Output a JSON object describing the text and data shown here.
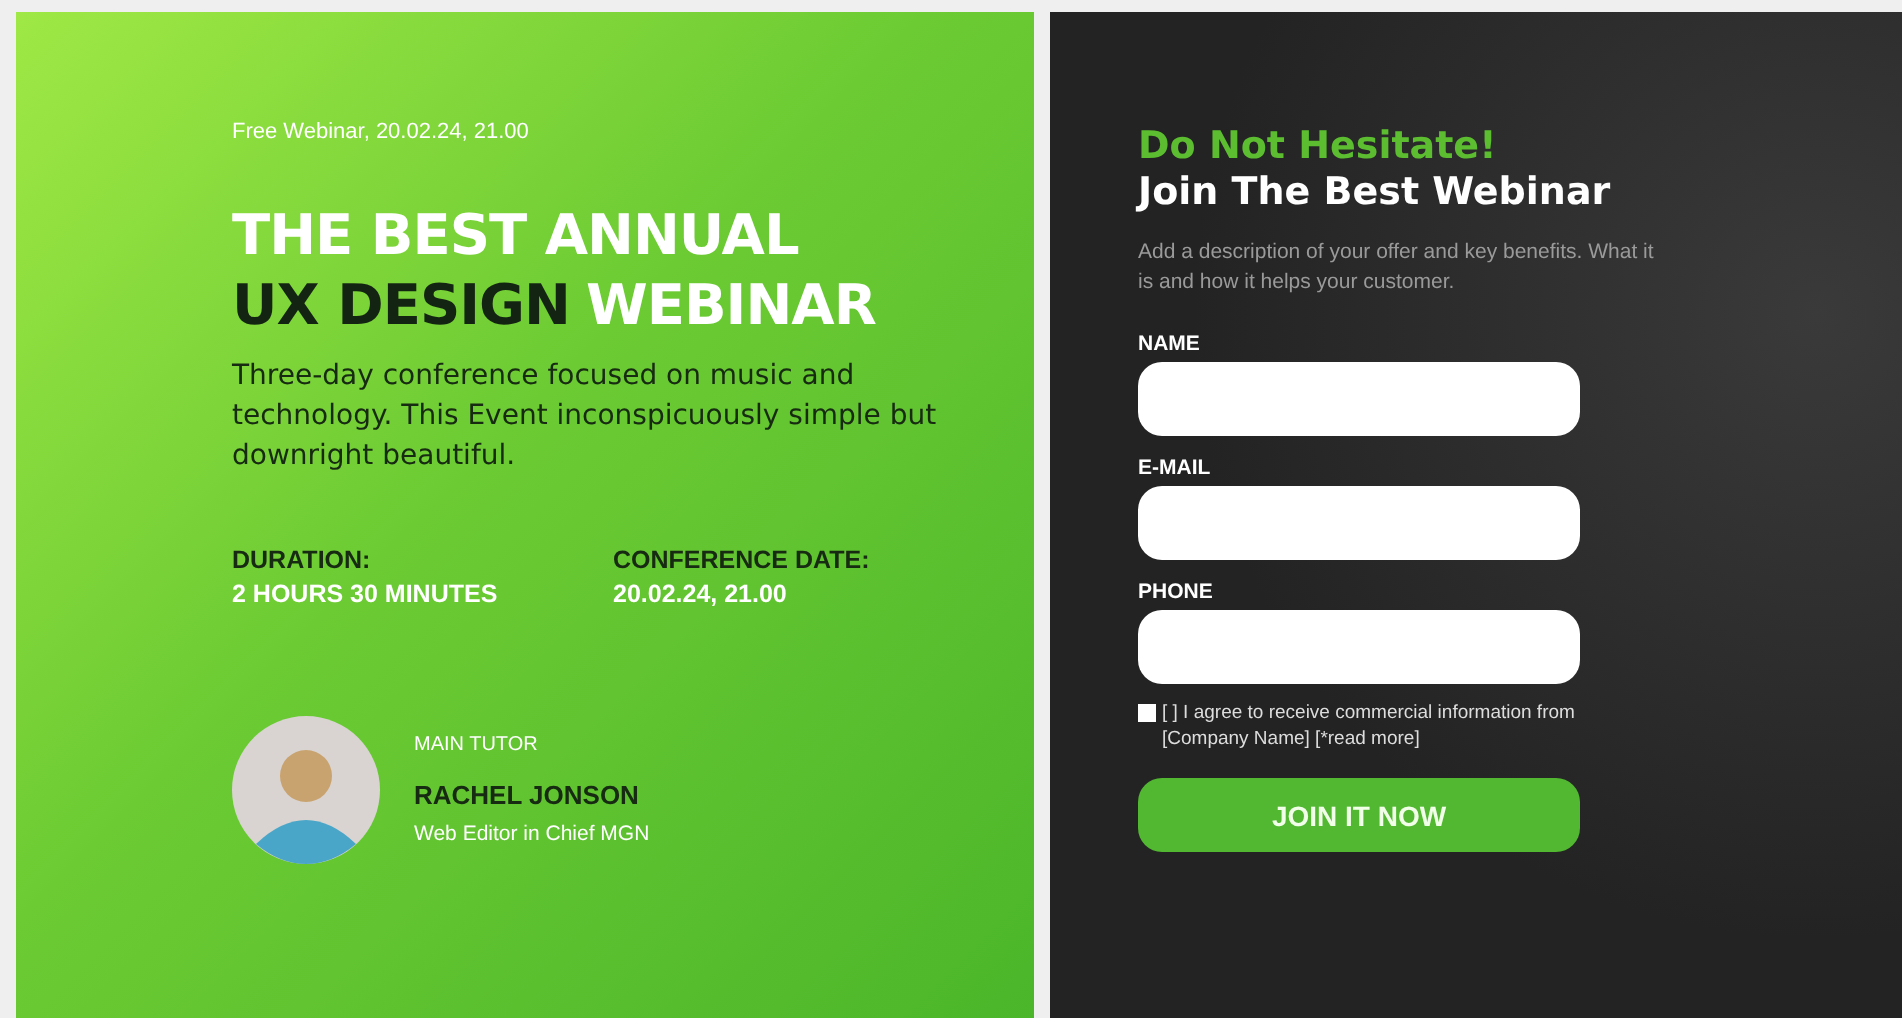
{
  "promo": {
    "eyebrow": "Free Webinar, 20.02.24, 21.00",
    "title_lines": [
      [
        {
          "text": "THE BEST ANNUAL",
          "dark": false
        }
      ],
      [
        {
          "text": "UX DESIGN",
          "dark": true
        },
        {
          "text": "WEBINAR",
          "dark": false
        }
      ]
    ],
    "description": "Three-day conference focused on music and technology. This Event inconspicuously simple but downright beautiful.",
    "facts": [
      {
        "label": "DURATION:",
        "value": "2 HOURS 30 MINUTES"
      },
      {
        "label": "CONFERENCE DATE:",
        "value": "20.02.24, 21.00"
      }
    ],
    "tutor": {
      "role": "MAIN TUTOR",
      "name": "RACHEL JONSON",
      "position": "Web Editor in Chief MGN"
    }
  },
  "signup": {
    "kicker": "Do Not Hesitate!",
    "heading": "Join The Best Webinar",
    "description": "Add a description of your offer and key benefits. What it is and how it helps your customer.",
    "fields": [
      {
        "label": "NAME"
      },
      {
        "label": "E-MAIL"
      },
      {
        "label": "PHONE"
      }
    ],
    "consent": {
      "checked": false,
      "text": "[ ] I agree to receive commercial information from [Company Name] [*read more]"
    },
    "button": "JOIN IT NOW"
  }
}
